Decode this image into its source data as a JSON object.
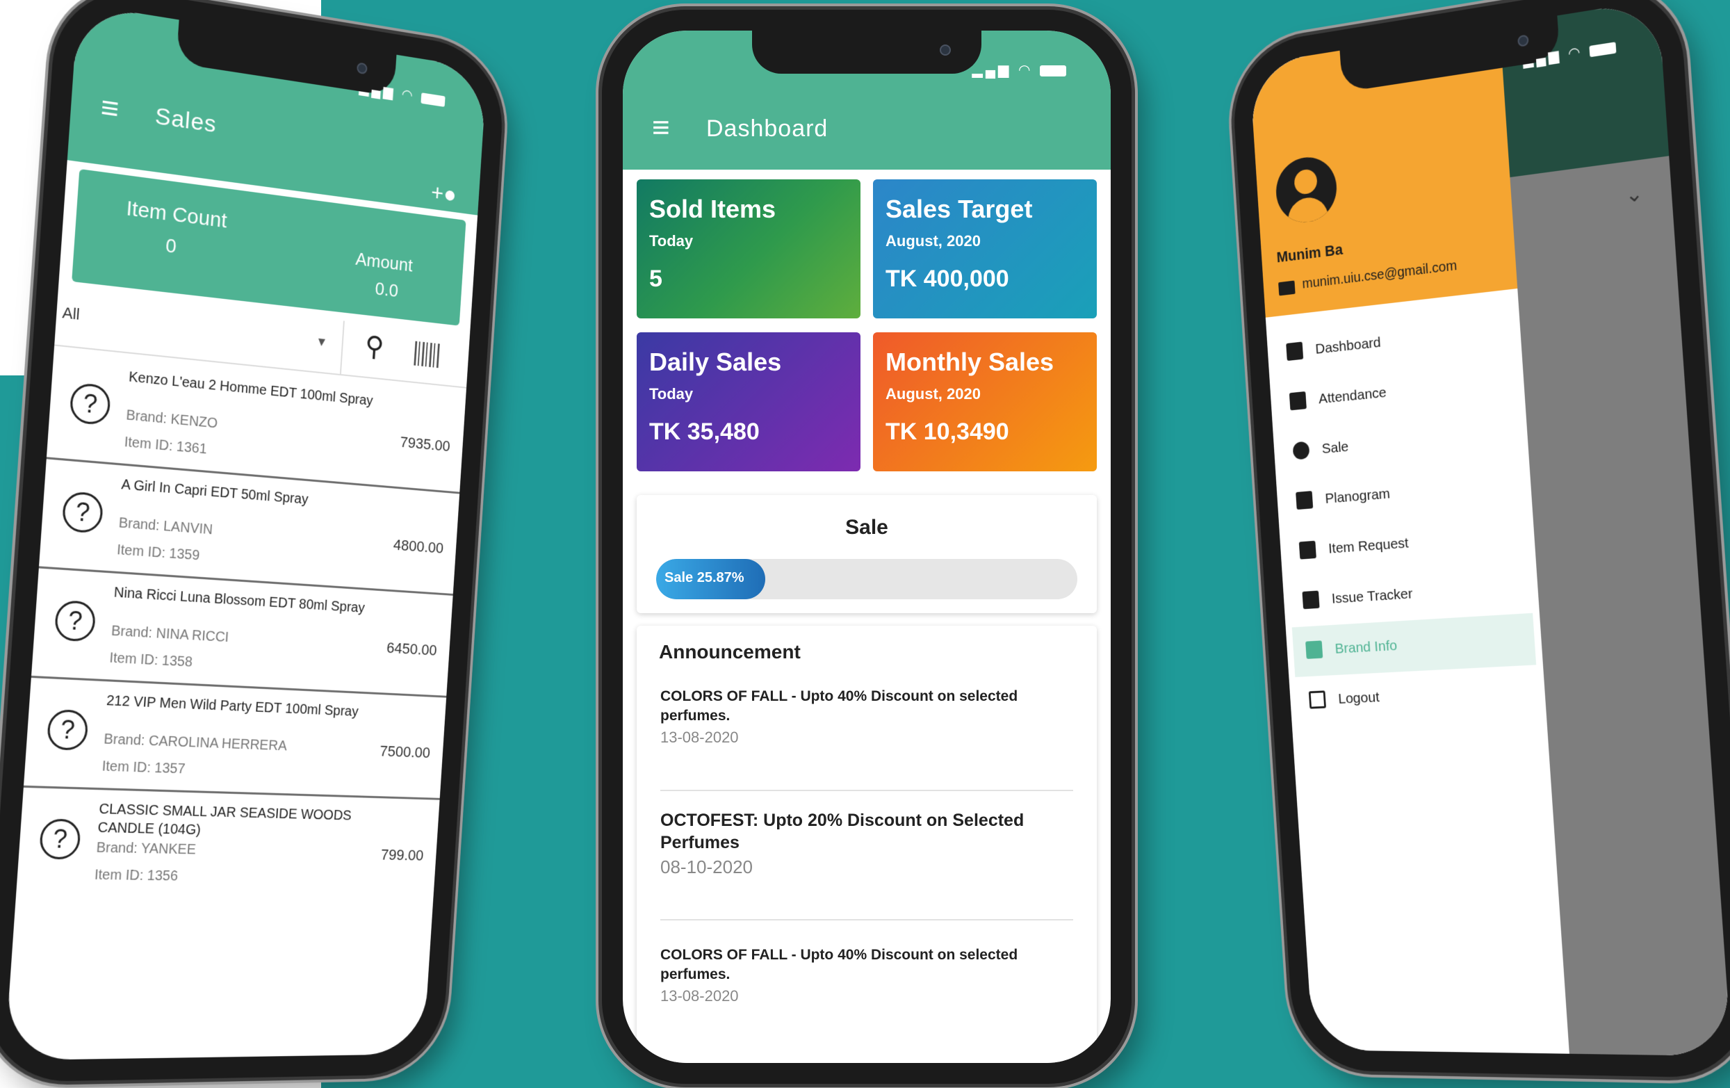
{
  "sales_screen": {
    "title": "Sales",
    "item_count_label": "Item Count",
    "item_count_value": "0",
    "amount_label": "Amount",
    "amount_value": "0.0",
    "filter_value": "All",
    "items": [
      {
        "name": "Kenzo L'eau 2 Homme EDT 100ml Spray",
        "brand": "Brand: KENZO",
        "item_id": "Item ID: 1361",
        "price": "7935.00"
      },
      {
        "name": "A Girl In Capri EDT 50ml Spray",
        "brand": "Brand: LANVIN",
        "item_id": "Item ID: 1359",
        "price": "4800.00"
      },
      {
        "name": "Nina Ricci Luna Blossom EDT 80ml Spray",
        "brand": "Brand: NINA RICCI",
        "item_id": "Item ID: 1358",
        "price": "6450.00"
      },
      {
        "name": "212 VIP Men Wild Party EDT 100ml Spray",
        "brand": "Brand: CAROLINA HERRERA",
        "item_id": "Item ID: 1357",
        "price": "7500.00"
      },
      {
        "name": "CLASSIC SMALL JAR SEASIDE WOODS CANDLE (104G)",
        "brand": "Brand: YANKEE",
        "item_id": "Item ID: 1356",
        "price": "799.00"
      }
    ]
  },
  "dashboard_screen": {
    "title": "Dashboard",
    "cards": {
      "sold": {
        "title": "Sold Items",
        "subtitle": "Today",
        "value": "5"
      },
      "target": {
        "title": "Sales Target",
        "subtitle": "August, 2020",
        "value": "TK 400,000"
      },
      "daily": {
        "title": "Daily Sales",
        "subtitle": "Today",
        "value": "TK 35,480"
      },
      "monthly": {
        "title": "Monthly Sales",
        "subtitle": "August, 2020",
        "value": "TK 10,3490"
      }
    },
    "sale_panel": {
      "title": "Sale",
      "progress_label": "Sale 25.87%",
      "progress_percent": 25.87
    },
    "announcement": {
      "title": "Announcement",
      "items": [
        {
          "text": "COLORS OF FALL - Upto 40% Discount on selected perfumes.",
          "date": "13-08-2020"
        },
        {
          "text": "OCTOFEST: Upto 20% Discount on Selected Perfumes",
          "date": "08-10-2020"
        },
        {
          "text": "COLORS OF FALL - Upto 40% Discount on selected perfumes.",
          "date": "13-08-2020"
        }
      ]
    }
  },
  "drawer_screen": {
    "user_name": "Munim Ba",
    "user_email": "munim.uiu.cse@gmail.com",
    "menu": [
      "Dashboard",
      "Attendance",
      "Sale",
      "Planogram",
      "Item Request",
      "Issue Tracker",
      "Brand Info",
      "Logout"
    ],
    "active_item": "Brand Info"
  },
  "colors": {
    "background_teal": "#1f9a98",
    "appbar_green": "#4fb393",
    "drawer_orange": "#f5a531"
  }
}
